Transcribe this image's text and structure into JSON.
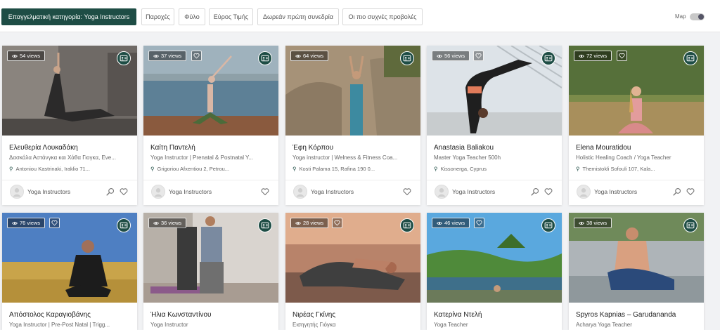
{
  "filters": {
    "category": "Επαγγελματική κατηγορία: Yoga Instructors",
    "services": "Παροχές",
    "gender": "Φύλο",
    "price": "Εύρος Τιμής",
    "free_session": "Δωρεάν πρώτη συνεδρία",
    "most_viewed": "Οι πιο συχνές προβολές",
    "map_label": "Map"
  },
  "colors": {
    "accent": "#1e4d45"
  },
  "cards": [
    {
      "views": "54 views",
      "name": "Ελευθερία Λουκαδάκη",
      "subtitle": "Δασκάλα Αστάνγκα και Χάθα Γιογκα, Eve...",
      "address": "Antoniou Kastrinaki, Iraklio 71...",
      "category": "Yoga Instructors"
    },
    {
      "views": "37 views",
      "name": "Καίτη Παντελή",
      "subtitle": "Yoga Instructor | Prenatal & Postnatal Y...",
      "address": "Grigoriou Afxentiou 2, Petrou...",
      "category": "Yoga Instructors"
    },
    {
      "views": "64 views",
      "name": "Έφη Κόρπου",
      "subtitle": "Yoga instructor | Welness & Fitness Coa...",
      "address": "Kosti Palama 15, Rafina 190 0...",
      "category": "Yoga Instructors"
    },
    {
      "views": "56 views",
      "name": "Anastasia Baliakou",
      "subtitle": "Master Yoga Teacher 500h",
      "address": "Kissonerga, Cyprus",
      "category": "Yoga Instructors"
    },
    {
      "views": "72 views",
      "name": "Elena Mouratidou",
      "subtitle": "Holistic Healing Coach / Yoga Teacher",
      "address": "Themistokli Sofouli 107, Kala...",
      "category": "Yoga Instructors"
    },
    {
      "views": "76 views",
      "name": "Απόστολος Καραγιοβάνης",
      "subtitle": "Yoga Instructor | Pre-Post Natal | Trigg...",
      "address": "",
      "category": ""
    },
    {
      "views": "36 views",
      "name": "Ήλια Κωνσταντίνου",
      "subtitle": "Yoga Instructor",
      "address": "",
      "category": ""
    },
    {
      "views": "28 views",
      "name": "Νιρέας Γκίνης",
      "subtitle": "Εισηγητής Γιόγκα",
      "address": "",
      "category": ""
    },
    {
      "views": "46 views",
      "name": "Κατερίνα Ντελή",
      "subtitle": "Yoga Teacher",
      "address": "",
      "category": ""
    },
    {
      "views": "38 views",
      "name": "Spyros Kapnias – Garudananda",
      "subtitle": "Acharya Yoga Teacher",
      "address": "",
      "category": ""
    }
  ]
}
